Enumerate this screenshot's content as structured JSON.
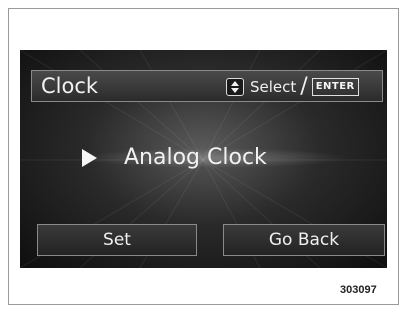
{
  "header": {
    "title": "Clock",
    "select_label": "Select",
    "separator": "/",
    "enter_label": "ENTER",
    "updown_icon": "up-down-arrows-icon"
  },
  "option": {
    "pointer_icon": "triangle-right-icon",
    "label": "Analog Clock"
  },
  "buttons": {
    "set_label": "Set",
    "back_label": "Go Back"
  },
  "figure_number": "303097",
  "colors": {
    "screen_bg": "#1a1a1a",
    "text": "#f2f2f2",
    "border": "#8a8a8a"
  }
}
